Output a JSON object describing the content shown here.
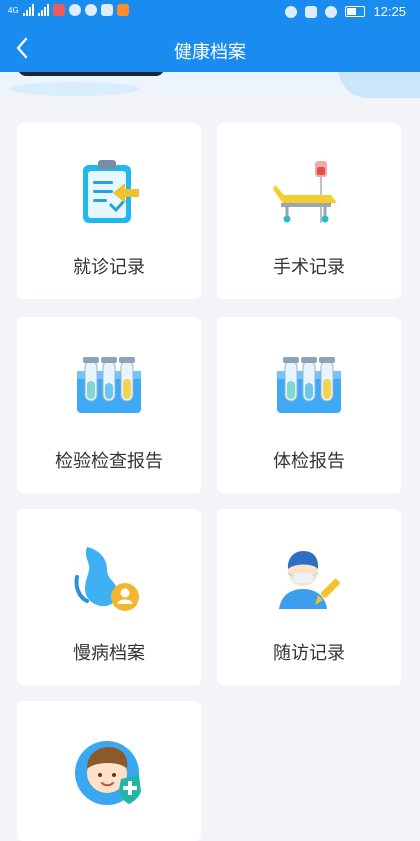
{
  "status_bar": {
    "time": "12:25",
    "net_label": "4G"
  },
  "nav": {
    "title": "健康档案"
  },
  "cards": [
    {
      "label": "就诊记录",
      "icon": "clipboard-icon"
    },
    {
      "label": "手术记录",
      "icon": "hospital-bed-icon"
    },
    {
      "label": "检验检查报告",
      "icon": "test-tubes-icon"
    },
    {
      "label": "体检报告",
      "icon": "test-tubes-icon"
    },
    {
      "label": "慢病档案",
      "icon": "stomach-icon"
    },
    {
      "label": "随访记录",
      "icon": "doctor-icon"
    },
    {
      "label": "",
      "icon": "insured-person-icon"
    }
  ],
  "colors": {
    "primary": "#1a8cf0",
    "page_bg": "#f2f4f8"
  }
}
